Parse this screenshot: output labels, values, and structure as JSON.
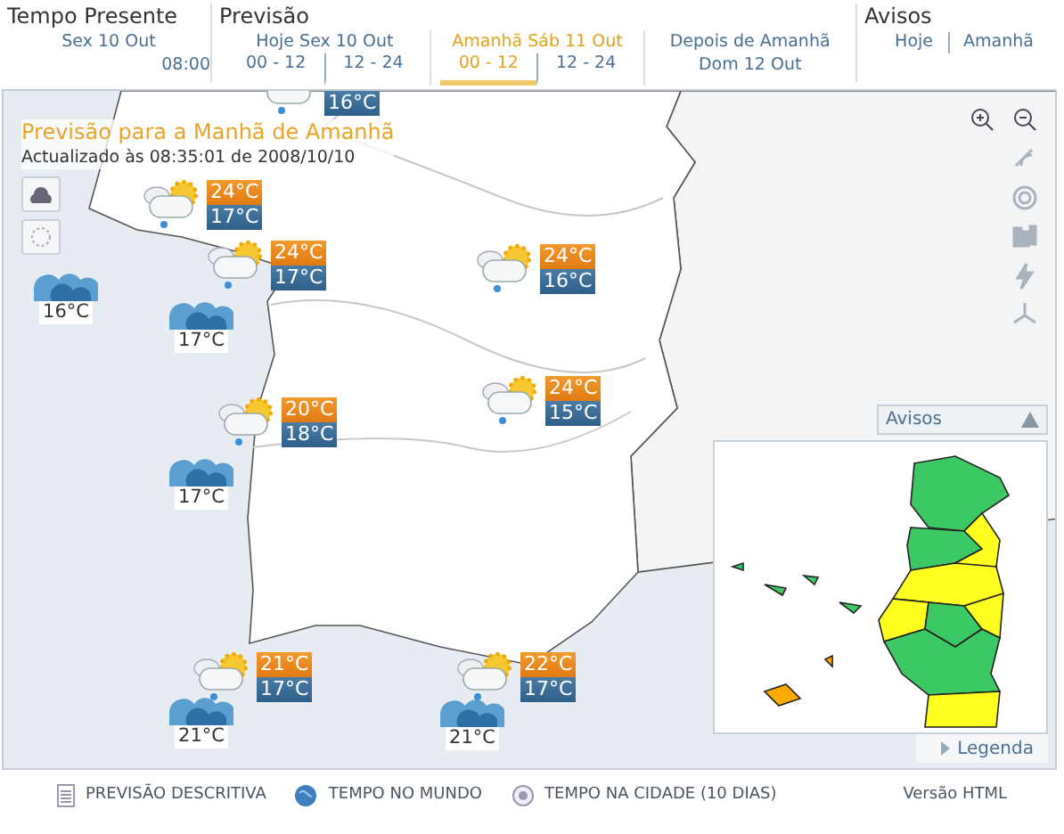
{
  "header": {
    "present": {
      "title": "Tempo Presente",
      "date": "Sex 10 Out",
      "time": "08:00"
    },
    "forecast": {
      "title": "Previsão",
      "days": [
        {
          "label": "Hoje Sex 10 Out",
          "selected": false,
          "periods": [
            {
              "label": "00 - 12",
              "selected": false
            },
            {
              "label": "12 - 24",
              "selected": false
            }
          ]
        },
        {
          "label": "Amanhã Sáb 11 Out",
          "selected": true,
          "periods": [
            {
              "label": "00 - 12",
              "selected": true
            },
            {
              "label": "12 - 24",
              "selected": false
            }
          ]
        },
        {
          "label": "Depois de Amanhã",
          "selected": false,
          "subtitle": "Dom 12 Out"
        }
      ]
    },
    "warnings": {
      "title": "Avisos",
      "links": [
        "Hoje",
        "Amanhã"
      ]
    }
  },
  "map": {
    "title": "Previsão para a Manhã de Amanhã",
    "updated": "Actualizado às 08:35:01 de 2008/10/10",
    "markers": [
      {
        "kind": "weather",
        "min": "16°C"
      },
      {
        "kind": "weather",
        "max": "24°C",
        "min": "17°C"
      },
      {
        "kind": "weather",
        "max": "24°C",
        "min": "17°C"
      },
      {
        "kind": "weather",
        "max": "24°C",
        "min": "16°C"
      },
      {
        "kind": "sea",
        "temp": "16°C"
      },
      {
        "kind": "sea",
        "temp": "17°C"
      },
      {
        "kind": "weather",
        "max": "20°C",
        "min": "18°C"
      },
      {
        "kind": "weather",
        "max": "24°C",
        "min": "15°C"
      },
      {
        "kind": "sea",
        "temp": "17°C"
      },
      {
        "kind": "weather",
        "max": "21°C",
        "min": "17°C"
      },
      {
        "kind": "weather",
        "max": "22°C",
        "min": "17°C"
      },
      {
        "kind": "sea",
        "temp": "21°C"
      },
      {
        "kind": "sea",
        "temp": "21°C"
      }
    ]
  },
  "warnings_panel": {
    "title": "Avisos",
    "legend": "Legenda"
  },
  "footer": {
    "links": [
      "PREVISÃO DESCRITIVA",
      "TEMPO NO MUNDO",
      "TEMPO NA CIDADE (10 DIAS)"
    ],
    "html": "Versão HTML"
  }
}
